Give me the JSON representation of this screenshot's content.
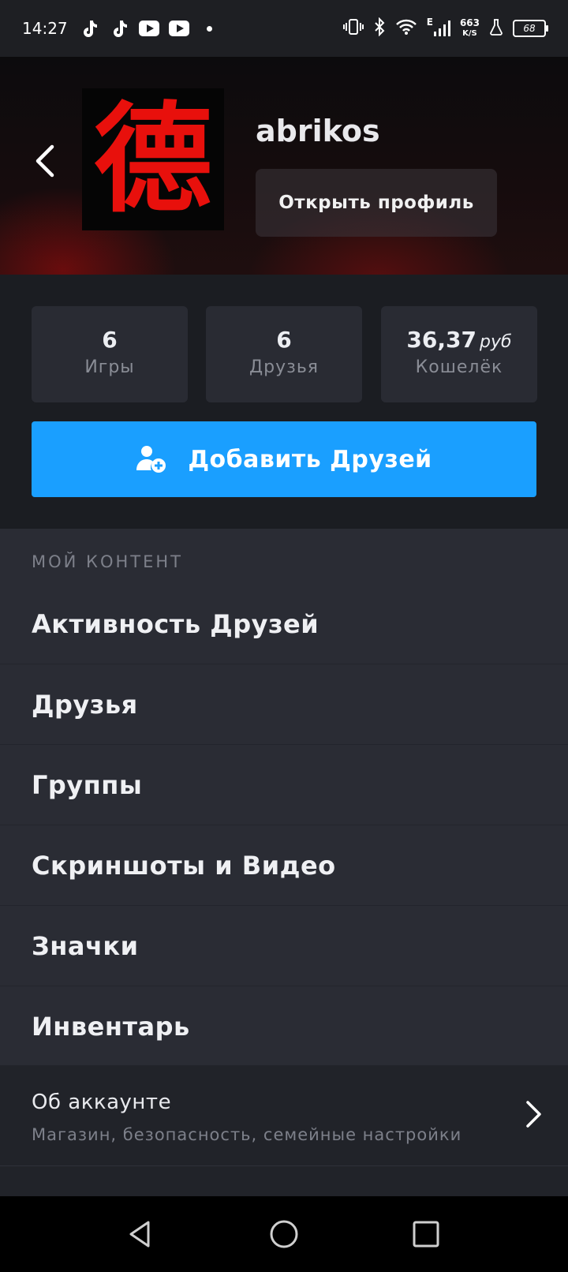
{
  "status_bar": {
    "time": "14:27",
    "network_type": "E",
    "speed_value": "663",
    "speed_unit": "K/S",
    "battery": "68",
    "apps": [
      "tiktok-icon",
      "tiktok-icon",
      "youtube-icon",
      "youtube-icon"
    ]
  },
  "profile": {
    "username": "abrikos",
    "avatar_glyph": "德",
    "open_profile_label": "Открыть профиль"
  },
  "stats": [
    {
      "value": "6",
      "unit": "",
      "label": "Игры"
    },
    {
      "value": "6",
      "unit": "",
      "label": "Друзья"
    },
    {
      "value": "36,37",
      "unit": "руб",
      "label": "Кошелёк"
    }
  ],
  "add_friends_label": "Добавить Друзей",
  "content": {
    "section_label": "МОЙ КОНТЕНТ",
    "items": [
      {
        "label": "Активность Друзей"
      },
      {
        "label": "Друзья"
      },
      {
        "label": "Группы"
      },
      {
        "label": "Скриншоты и Видео"
      },
      {
        "label": "Значки"
      },
      {
        "label": "Инвентарь"
      }
    ]
  },
  "account": {
    "title": "Об аккаунте",
    "subtitle": "Магазин, безопасность, семейные настройки"
  },
  "colors": {
    "accent": "#1a9fff",
    "background": "#1b1d22",
    "menu_background": "#2a2c34",
    "avatar_glyph": "#e8100c"
  }
}
